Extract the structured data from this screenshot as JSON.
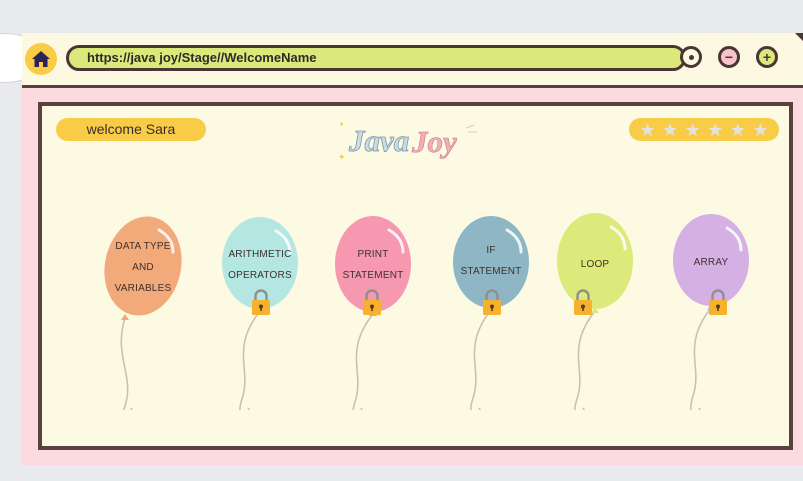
{
  "browser": {
    "url": "https://java joy/Stage//WelcomeName"
  },
  "header": {
    "welcome_text": "welcome Sara",
    "logo_text": "JavaJoy",
    "stars_total": 6,
    "stars_earned": 0
  },
  "colors": {
    "accent_yellow": "#f9cc48",
    "url_green": "#dbe97b",
    "frame_pink": "#fbdadf",
    "border_brown": "#5a4040",
    "panel_cream": "#fdfae3"
  },
  "balloons": [
    {
      "lines": [
        "DATA TYPE",
        "AND",
        "VARIABLES"
      ],
      "color": "#f2aa7a",
      "locked": false
    },
    {
      "lines": [
        "ARITHMETIC",
        "OPERATORS"
      ],
      "color": "#b4e6e2",
      "locked": true
    },
    {
      "lines": [
        "PRINT",
        "STATEMENT"
      ],
      "color": "#f598b0",
      "locked": true
    },
    {
      "lines": [
        "IF",
        "STATEMENT"
      ],
      "color": "#8eb6c4",
      "locked": true
    },
    {
      "lines": [
        "LOOP"
      ],
      "color": "#dce97b",
      "locked": true
    },
    {
      "lines": [
        "ARRAY"
      ],
      "color": "#d5b0e4",
      "locked": true
    }
  ]
}
